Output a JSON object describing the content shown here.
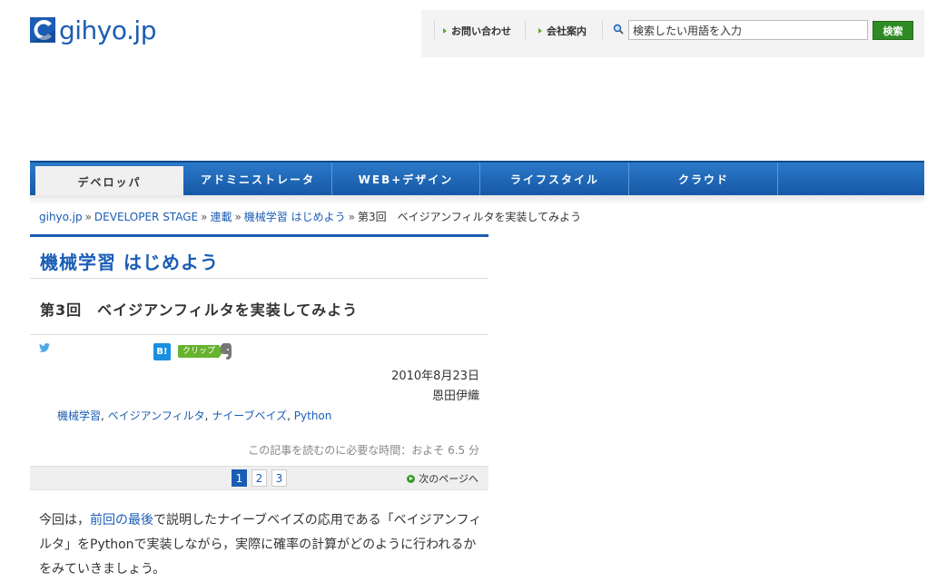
{
  "site": {
    "logo_text": "gihyo.jp"
  },
  "utility": {
    "contact": "お問い合わせ",
    "company": "会社案内",
    "search_value": "検索したい用語を入力",
    "search_button": "検索"
  },
  "nav": {
    "tabs": [
      {
        "label": "デベロッパ",
        "active": true
      },
      {
        "label": "アドミニストレータ",
        "active": false
      },
      {
        "label": "WEB+デザイン",
        "active": false
      },
      {
        "label": "ライフスタイル",
        "active": false
      },
      {
        "label": "クラウド",
        "active": false
      }
    ]
  },
  "breadcrumb": {
    "items": [
      "gihyo.jp",
      "DEVELOPER STAGE",
      "連載",
      "機械学習 はじめよう"
    ],
    "current": "第3回　ベイジアンフィルタを実装してみよう",
    "separator": "»"
  },
  "article": {
    "series_title": "機械学習 はじめよう",
    "title": "第3回　ベイジアンフィルタを実装してみよう",
    "hatena_label": "B!",
    "clip_label": "クリップ",
    "date": "2010年8月23日",
    "author": "恩田伊織",
    "tags": [
      "機械学習",
      "ベイジアンフィルタ",
      "ナイーブベイズ",
      "Python"
    ],
    "read_time": "この記事を読むのに必要な時間：およそ 6.5 分",
    "pages": [
      "1",
      "2",
      "3"
    ],
    "current_page": "1",
    "next_page": "次のページへ",
    "body": {
      "pre": "今回は，",
      "link": "前回の最後",
      "post": "で説明したナイーブベイズの応用である「ベイジアンフィルタ」をPythonで実装しながら，実際に確率の計算がどのように行われるかをみていきましょう。"
    }
  },
  "colors": {
    "brand": "#1a5db5",
    "nav": "#1559a6",
    "green": "#2e8b24"
  }
}
